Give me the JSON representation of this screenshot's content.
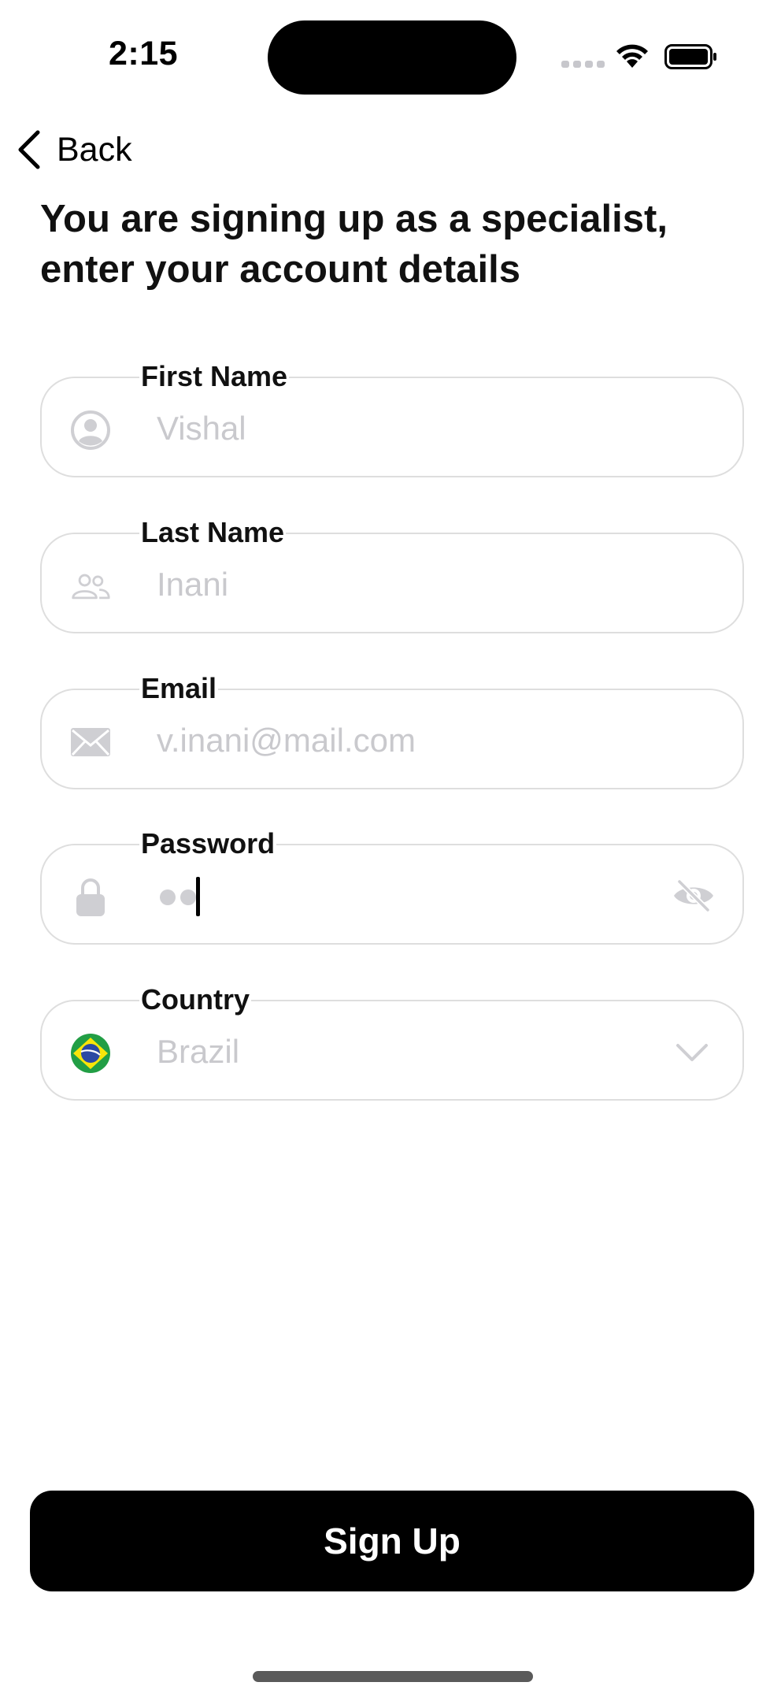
{
  "status_bar": {
    "time": "2:15"
  },
  "nav": {
    "back_label": "Back"
  },
  "title": "You are signing up as a specialist, enter your account details",
  "fields": {
    "first_name": {
      "label": "First Name",
      "placeholder": "Vishal",
      "icon": "person-circle-icon"
    },
    "last_name": {
      "label": "Last Name",
      "placeholder": "Inani",
      "icon": "people-icon"
    },
    "email": {
      "label": "Email",
      "placeholder": "v.inani@mail.com",
      "icon": "envelope-icon"
    },
    "password": {
      "label": "Password",
      "masked_chars": 2,
      "icon": "lock-icon",
      "toggle_icon": "eye-slash-icon"
    },
    "country": {
      "label": "Country",
      "value": "Brazil",
      "icon": "brazil-flag-icon"
    }
  },
  "actions": {
    "signup_label": "Sign Up"
  },
  "colors": {
    "placeholder": "#c9c9cd",
    "border": "#dedede",
    "primary_button": "#000000"
  }
}
